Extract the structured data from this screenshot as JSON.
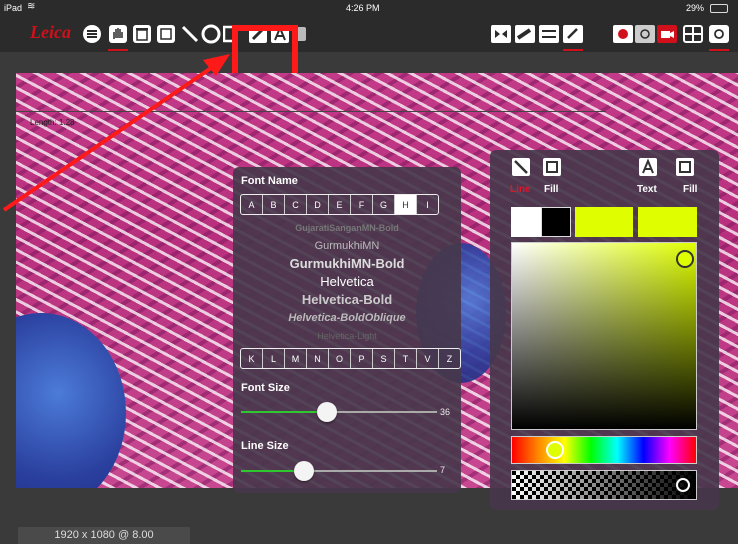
{
  "status_bar": {
    "device": "iPad",
    "time": "4:26 PM",
    "battery": "29%"
  },
  "toolbar": {
    "logo": "Leica"
  },
  "viewer": {
    "scale_label": "Length: 1.28"
  },
  "font_panel": {
    "font_name_label": "Font Name",
    "letters_top": [
      "A",
      "B",
      "C",
      "D",
      "E",
      "F",
      "G",
      "H",
      "I"
    ],
    "letters_top_selected": "H",
    "letters_bottom": [
      "K",
      "L",
      "M",
      "N",
      "O",
      "P",
      "S",
      "T",
      "V",
      "Z"
    ],
    "fonts": [
      "GujaratiSanganMN-Bold",
      "GurmukhiMN",
      "GurmukhiMN-Bold",
      "Helvetica",
      "Helvetica-Bold",
      "Helvetica-BoldOblique",
      "Helvetica-Light"
    ],
    "selected_font": "Helvetica",
    "font_size_label": "Font Size",
    "font_size_value": "36",
    "font_size_fraction": 0.44,
    "line_size_label": "Line Size",
    "line_size_value": "7",
    "line_size_fraction": 0.32
  },
  "color_panel": {
    "line_label": "Line",
    "fill_label_left": "Fill",
    "text_label": "Text",
    "fill_label_right": "Fill",
    "accent_color": "#dfff00",
    "active_color": "#e0162b"
  },
  "footer": {
    "resolution": "1920 x 1080 @ 8.00"
  }
}
